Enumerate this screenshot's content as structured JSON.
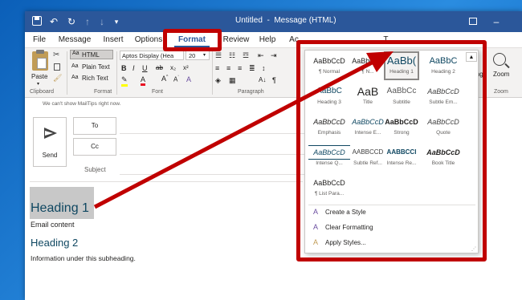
{
  "titlebar": {
    "title": "Untitled  -  Message (HTML)"
  },
  "menu": {
    "file": "File",
    "message": "Message",
    "insert": "Insert",
    "options": "Options",
    "format_text": "Format Text",
    "review": "Review",
    "help": "Help",
    "partial": "Ac",
    "partial_right": "T..."
  },
  "ribbon": {
    "paste": "Paste",
    "html": "HTML",
    "plain_text": "Plain Text",
    "rich_text": "Rich Text",
    "font_name": "Aptos Display (Hea",
    "font_size": "20",
    "clipboard_label": "Clipboard",
    "format_label": "Format",
    "font_label": "Font",
    "paragraph_label": "Paragraph",
    "editing_label": "iting",
    "zoom_button": "Zoom",
    "zoom_label": "Zoom"
  },
  "mailtips": "We can't show MailTips right now.",
  "compose": {
    "send": "Send",
    "to": "To",
    "cc": "Cc",
    "subject": "Subject"
  },
  "body": {
    "heading1": "Heading 1",
    "content": "Email content",
    "heading2": "Heading 2",
    "sub_content": "Information under this subheading."
  },
  "styles": {
    "rows": [
      [
        {
          "preview": "AaBbCcD",
          "name": "¶ Normal"
        },
        {
          "preview": "AaBbCcD",
          "name": "¶ N..."
        },
        {
          "preview": "AaBb(",
          "name": "Heading 1"
        },
        {
          "preview": "AaBbC",
          "name": "Heading 2"
        }
      ],
      [
        {
          "preview": "AaBbC",
          "name": "Heading 3"
        },
        {
          "preview": "AaB",
          "name": "Title"
        },
        {
          "preview": "AaBbCc",
          "name": "Subtitle"
        },
        {
          "preview": "AaBbCcD",
          "name": "Subtle Em..."
        }
      ],
      [
        {
          "preview": "AaBbCcD",
          "name": "Emphasis"
        },
        {
          "preview": "AaBbCcD",
          "name": "Intense E..."
        },
        {
          "preview": "AaBbCcD",
          "name": "Strong"
        },
        {
          "preview": "AaBbCcD",
          "name": "Quote"
        }
      ],
      [
        {
          "preview": "AaBbCcD",
          "name": "Intense Q..."
        },
        {
          "preview": "AABBCCD",
          "name": "Subtle Ref..."
        },
        {
          "preview": "AABBCCI",
          "name": "Intense Re..."
        },
        {
          "preview": "AaBbCcD",
          "name": "Book Title"
        }
      ],
      [
        {
          "preview": "AaBbCcD",
          "name": "¶ List Para..."
        }
      ]
    ],
    "create": "Create a Style",
    "clear": "Clear Formatting",
    "apply": "Apply Styles..."
  },
  "colors": {
    "accent": "#2b579a",
    "highlight_red": "#c00000",
    "heading_blue": "#0f4761",
    "heading_selection": "#c8c8c8"
  }
}
